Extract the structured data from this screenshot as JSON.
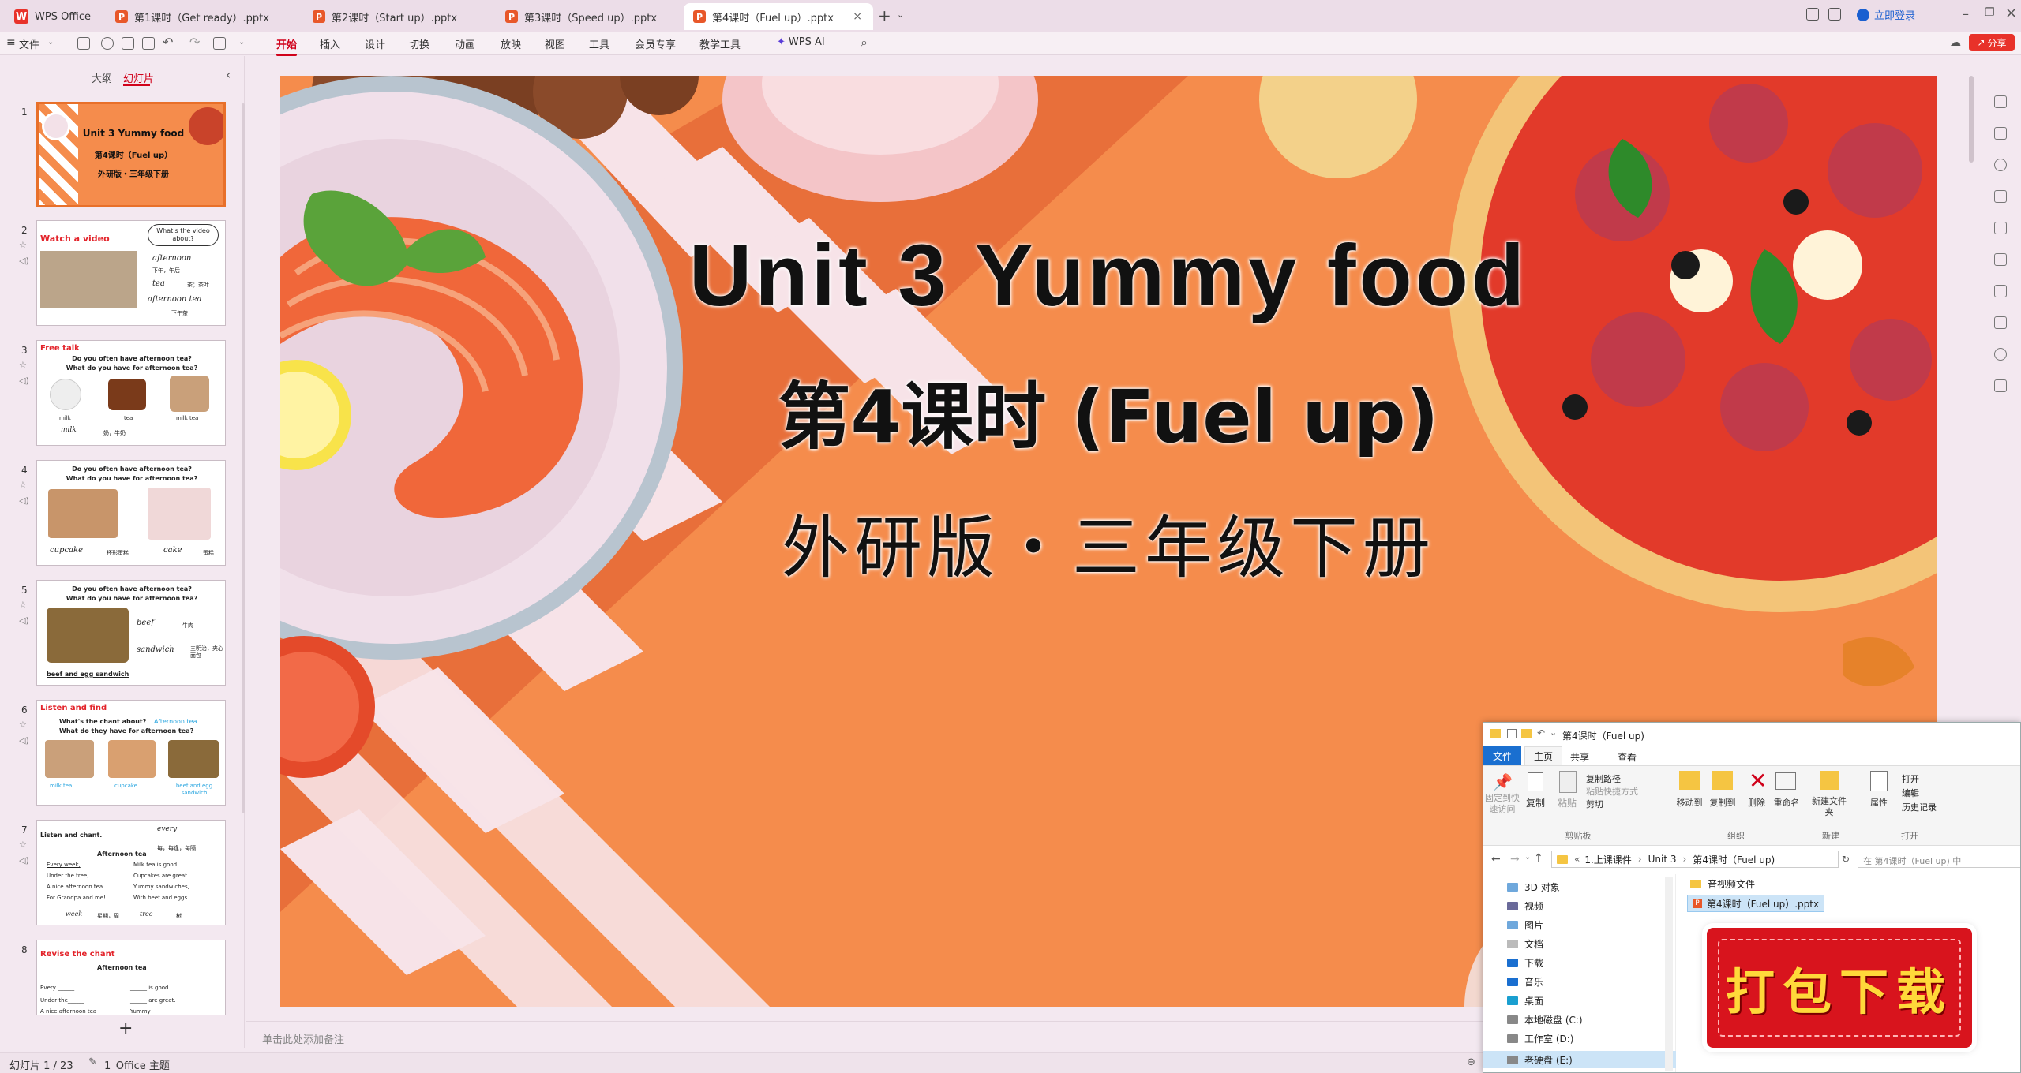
{
  "app": {
    "name": "WPS Office"
  },
  "tabs": [
    {
      "label": "第1课时（Get ready）.pptx"
    },
    {
      "label": "第2课时（Start up）.pptx"
    },
    {
      "label": "第3课时（Speed up）.pptx"
    },
    {
      "label": "第4课时（Fuel up）.pptx"
    }
  ],
  "window": {
    "login": "立即登录",
    "share": "分享"
  },
  "ribbon": {
    "file": "文件",
    "menus": [
      "开始",
      "插入",
      "设计",
      "切换",
      "动画",
      "放映",
      "视图",
      "工具",
      "会员专享",
      "教学工具"
    ],
    "wps_ai": "WPS AI"
  },
  "panel": {
    "outline": "大纲",
    "slides": "幻灯片",
    "add": "+"
  },
  "thumbs": [
    {
      "num": "1",
      "title": "Unit 3  Yummy food",
      "sub": "第4课时（Fuel up）",
      "sub2": "外研版・三年级下册"
    },
    {
      "num": "2",
      "title": "Watch a video",
      "bubble": "What's the video about?",
      "w1": "afternoon",
      "w1c": "下午，午后",
      "w2": "tea",
      "w2c": "茶；茶叶",
      "w3": "afternoon tea",
      "w3c": "下午茶"
    },
    {
      "num": "3",
      "title": "Free talk",
      "q1": "Do you often have afternoon tea?",
      "q2": "What do you have for afternoon tea?",
      "a": "milk",
      "b": "tea",
      "c": "milk tea",
      "d": "milk",
      "dc": "奶，牛奶"
    },
    {
      "num": "4",
      "q1": "Do you often have afternoon tea?",
      "q2": "What do you have for afternoon tea?",
      "a": "cupcake",
      "ac": "杯形蛋糕",
      "b": "cake",
      "bc": "蛋糕"
    },
    {
      "num": "5",
      "q1": "Do you often have afternoon tea?",
      "q2": "What do you have for afternoon tea?",
      "a": "beef",
      "ac": "牛肉",
      "b": "sandwich",
      "bc": "三明治，夹心面包",
      "c": "beef and egg sandwich"
    },
    {
      "num": "6",
      "title": "Listen and find",
      "q1": "What's the chant about?",
      "ans": "Afternoon tea.",
      "q2": "What do they have for afternoon tea?",
      "a": "milk tea",
      "b": "cupcake",
      "c": "beef and egg sandwich"
    },
    {
      "num": "7",
      "title": "Listen and chant.",
      "t": "Afternoon tea",
      "every": "every",
      "ec": "每，每逢，每隔",
      "l1": "Every week,",
      "l2": "Under the tree,",
      "l3": "A nice afternoon tea",
      "l4": "For Grandpa and me!",
      "r1": "Milk tea is good.",
      "r2": "Cupcakes are great.",
      "r3": "Yummy sandwiches,",
      "r4": "With beef and eggs.",
      "w": "week",
      "wc": "星期，周",
      "tr": "tree",
      "trc": "树"
    },
    {
      "num": "8",
      "title": "Revise the chant",
      "t": "Afternoon tea",
      "l1": "Every ______",
      "l2": "Under the______",
      "l3": "A nice afternoon tea",
      "r1": "______ is good.",
      "r2": "______ are great.",
      "r3": "Yummy"
    }
  ],
  "slide": {
    "title": "Unit 3  Yummy food",
    "lesson": "第4课时  (Fuel up)",
    "edition": "外研版・三年级下册"
  },
  "notes": {
    "placeholder": "单击此处添加备注"
  },
  "status": {
    "slide_count": "幻灯片 1 / 23",
    "theme": "1_Office 主题"
  },
  "explorer": {
    "title": "第4课时（Fuel up)",
    "tabs": [
      "文件",
      "主页",
      "共享",
      "查看"
    ],
    "groups": {
      "clipboard": "剪贴板",
      "organize": "组织",
      "new": "新建",
      "open": "打开"
    },
    "buttons": {
      "pin": "固定到快速访问",
      "copy": "复制",
      "paste": "粘贴",
      "copy_path": "复制路径",
      "paste_shortcut": "粘贴快捷方式",
      "cut": "剪切",
      "move_to": "移动到",
      "copy_to": "复制到",
      "delete": "删除",
      "rename": "重命名",
      "new_folder": "新建文件夹",
      "properties": "属性",
      "open": "打开",
      "edit": "编辑",
      "history": "历史记录"
    },
    "path": [
      "1.上课课件",
      "Unit 3",
      "第4课时（Fuel up)"
    ],
    "search": "在 第4课时（Fuel up) 中",
    "nav": [
      "3D 对象",
      "视频",
      "图片",
      "文档",
      "下载",
      "音乐",
      "桌面",
      "本地磁盘 (C:)",
      "工作室 (D:)",
      "老硬盘 (E:)"
    ],
    "files": [
      {
        "name": "音视频文件"
      },
      {
        "name": "第4课时（Fuel up）.pptx"
      }
    ]
  },
  "badge": {
    "label": "打包下载"
  },
  "colors": {
    "accent": "#d0021b",
    "slide_bg": "#f58c4c",
    "badge_bg": "#d8141d"
  }
}
